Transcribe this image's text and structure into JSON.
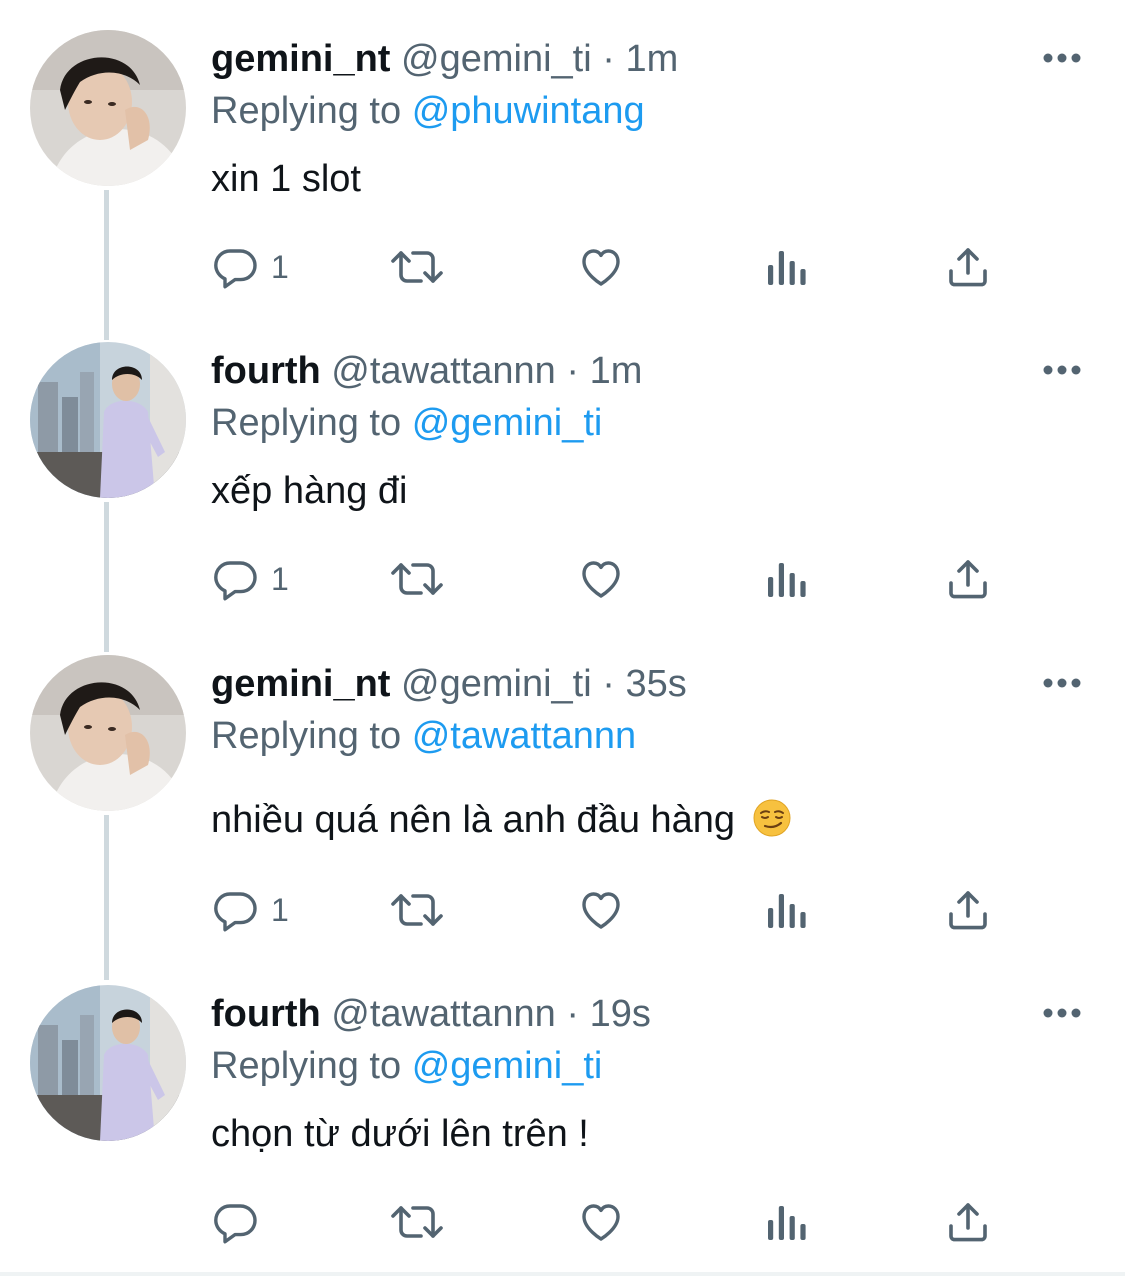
{
  "tweets": [
    {
      "display_name": "gemini_nt",
      "handle": "@gemini_ti",
      "separator": "·",
      "time": "1m",
      "replying_prefix": "Replying to",
      "replying_to": "@phuwintang",
      "text": "xin 1 slot",
      "emoji": "",
      "reply_count": "1",
      "avatar": "gemini-avatar"
    },
    {
      "display_name": "fourth",
      "handle": "@tawattannn",
      "separator": "·",
      "time": "1m",
      "replying_prefix": "Replying to",
      "replying_to": "@gemini_ti",
      "text": "xếp hàng đi",
      "emoji": "",
      "reply_count": "1",
      "avatar": "fourth-avatar"
    },
    {
      "display_name": "gemini_nt",
      "handle": "@gemini_ti",
      "separator": "·",
      "time": "35s",
      "replying_prefix": "Replying to",
      "replying_to": "@tawattannn",
      "text": "nhiều quá nên là anh đầu hàng",
      "emoji": "smirking-face",
      "reply_count": "1",
      "avatar": "gemini-avatar"
    },
    {
      "display_name": "fourth",
      "handle": "@tawattannn",
      "separator": "·",
      "time": "19s",
      "replying_prefix": "Replying to",
      "replying_to": "@gemini_ti",
      "text": "chọn từ dưới lên trên !",
      "emoji": "",
      "reply_count": "",
      "avatar": "fourth-avatar"
    }
  ],
  "colors": {
    "text": "#0f1419",
    "secondary": "#536471",
    "link": "#1d9bf0",
    "thread_line": "#cfd9de"
  },
  "icons": {
    "reply": "reply-icon",
    "retweet": "retweet-icon",
    "like": "like-icon",
    "views": "views-icon",
    "share": "share-icon",
    "more": "more-icon"
  }
}
